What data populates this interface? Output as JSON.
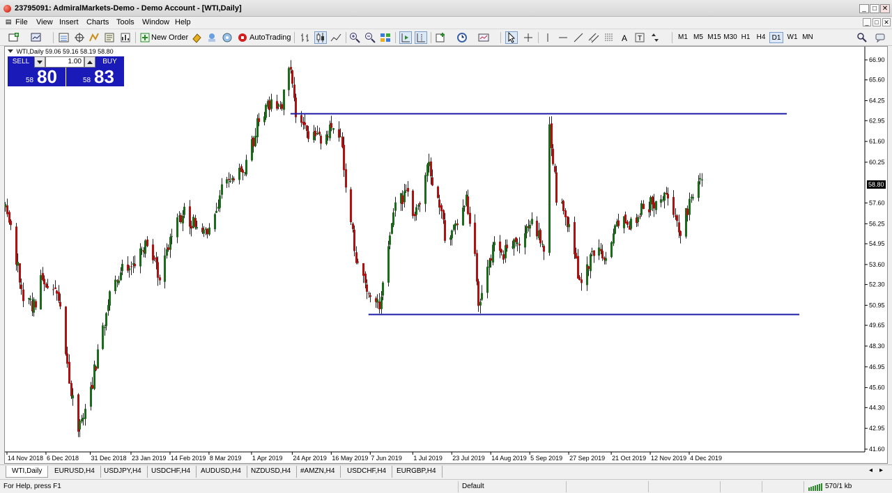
{
  "window": {
    "title": "23795091: AdmiralMarkets-Demo - Demo Account - [WTI,Daily]"
  },
  "menu": [
    "File",
    "View",
    "Insert",
    "Charts",
    "Tools",
    "Window",
    "Help"
  ],
  "toolbar": {
    "new_order": "New Order",
    "autotrading": "AutoTrading",
    "timeframes": [
      "M1",
      "M5",
      "M15",
      "M30",
      "H1",
      "H4",
      "D1",
      "W1",
      "MN"
    ],
    "active_timeframe": "D1"
  },
  "chart": {
    "header": "WTI,Daily  59.06 59.16 58.19 58.80",
    "one_click": {
      "sell_label": "SELL",
      "buy_label": "BUY",
      "volume": "1.00",
      "sell_small": "58",
      "sell_big": "80",
      "buy_small": "58",
      "buy_big": "83"
    },
    "current_price_label": "58.80",
    "colors": {
      "bull": "#1a6b1a",
      "bear": "#b01010",
      "wick": "#222222",
      "level_line": "#1c1ca8",
      "price_tag_bg": "#000000"
    }
  },
  "chart_data": {
    "type": "candlestick",
    "symbol": "WTI",
    "timeframe": "Daily",
    "y_ticks": [
      "66.90",
      "65.60",
      "64.25",
      "62.95",
      "61.60",
      "60.25",
      "58.80",
      "57.60",
      "56.25",
      "54.95",
      "53.60",
      "52.30",
      "50.95",
      "49.65",
      "48.30",
      "46.95",
      "45.60",
      "44.30",
      "42.95",
      "41.60"
    ],
    "ylim": [
      41.6,
      66.9
    ],
    "x_ticks": [
      "14 Nov 2018",
      "6 Dec 2018",
      "31 Dec 2018",
      "23 Jan 2019",
      "14 Feb 2019",
      "8 Mar 2019",
      "1 Apr 2019",
      "24 Apr 2019",
      "16 May 2019",
      "7 Jun 2019",
      "1 Jul 2019",
      "23 Jul 2019",
      "14 Aug 2019",
      "5 Sep 2019",
      "27 Sep 2019",
      "21 Oct 2019",
      "12 Nov 2019",
      "4 Dec 2019"
    ],
    "horizontal_levels": [
      {
        "price": 63.4,
        "from": "23 Apr 2019",
        "to": "end"
      },
      {
        "price": 50.35,
        "from": "6 Jun 2019",
        "to": "end"
      }
    ],
    "last_close": 58.8,
    "anchors": [
      {
        "date": "12 Nov 2018",
        "close": 57.8
      },
      {
        "date": "16 Nov 2018",
        "close": 56.4
      },
      {
        "date": "23 Nov 2018",
        "close": 50.9
      },
      {
        "date": "30 Nov 2018",
        "close": 50.9
      },
      {
        "date": "4 Dec 2018",
        "close": 52.9
      },
      {
        "date": "13 Dec 2018",
        "close": 51.5
      },
      {
        "date": "19 Dec 2018",
        "close": 46.2
      },
      {
        "date": "24 Dec 2018",
        "close": 43.0
      },
      {
        "date": "31 Dec 2018",
        "close": 45.4
      },
      {
        "date": "4 Jan 2019",
        "close": 47.9
      },
      {
        "date": "11 Jan 2019",
        "close": 51.6
      },
      {
        "date": "18 Jan 2019",
        "close": 53.6
      },
      {
        "date": "25 Jan 2019",
        "close": 53.5
      },
      {
        "date": "1 Feb 2019",
        "close": 55.3
      },
      {
        "date": "8 Feb 2019",
        "close": 52.7
      },
      {
        "date": "15 Feb 2019",
        "close": 55.6
      },
      {
        "date": "22 Feb 2019",
        "close": 57.2
      },
      {
        "date": "1 Mar 2019",
        "close": 55.8
      },
      {
        "date": "8 Mar 2019",
        "close": 56.1
      },
      {
        "date": "15 Mar 2019",
        "close": 58.5
      },
      {
        "date": "22 Mar 2019",
        "close": 59.0
      },
      {
        "date": "29 Mar 2019",
        "close": 60.1
      },
      {
        "date": "5 Apr 2019",
        "close": 63.1
      },
      {
        "date": "12 Apr 2019",
        "close": 63.9
      },
      {
        "date": "18 Apr 2019",
        "close": 64.0
      },
      {
        "date": "23 Apr 2019",
        "close": 66.3
      },
      {
        "date": "26 Apr 2019",
        "close": 63.3
      },
      {
        "date": "3 May 2019",
        "close": 61.9
      },
      {
        "date": "10 May 2019",
        "close": 61.7
      },
      {
        "date": "17 May 2019",
        "close": 62.8
      },
      {
        "date": "22 May 2019",
        "close": 61.4
      },
      {
        "date": "24 May 2019",
        "close": 58.6
      },
      {
        "date": "31 May 2019",
        "close": 53.5
      },
      {
        "date": "5 Jun 2019",
        "close": 51.7
      },
      {
        "date": "12 Jun 2019",
        "close": 51.1
      },
      {
        "date": "14 Jun 2019",
        "close": 52.5
      },
      {
        "date": "21 Jun 2019",
        "close": 57.4
      },
      {
        "date": "28 Jun 2019",
        "close": 58.5
      },
      {
        "date": "2 Jul 2019",
        "close": 56.3
      },
      {
        "date": "10 Jul 2019",
        "close": 60.4
      },
      {
        "date": "15 Jul 2019",
        "close": 57.6
      },
      {
        "date": "19 Jul 2019",
        "close": 55.6
      },
      {
        "date": "26 Jul 2019",
        "close": 56.2
      },
      {
        "date": "31 Jul 2019",
        "close": 58.1
      },
      {
        "date": "5 Aug 2019",
        "close": 54.7
      },
      {
        "date": "7 Aug 2019",
        "close": 51.1
      },
      {
        "date": "16 Aug 2019",
        "close": 54.9
      },
      {
        "date": "23 Aug 2019",
        "close": 54.2
      },
      {
        "date": "30 Aug 2019",
        "close": 55.1
      },
      {
        "date": "6 Sep 2019",
        "close": 56.5
      },
      {
        "date": "13 Sep 2019",
        "close": 54.8
      },
      {
        "date": "16 Sep 2019",
        "close": 62.5
      },
      {
        "date": "20 Sep 2019",
        "close": 58.1
      },
      {
        "date": "27 Sep 2019",
        "close": 55.9
      },
      {
        "date": "3 Oct 2019",
        "close": 52.4
      },
      {
        "date": "11 Oct 2019",
        "close": 54.7
      },
      {
        "date": "18 Oct 2019",
        "close": 53.8
      },
      {
        "date": "25 Oct 2019",
        "close": 56.6
      },
      {
        "date": "1 Nov 2019",
        "close": 56.2
      },
      {
        "date": "8 Nov 2019",
        "close": 57.2
      },
      {
        "date": "15 Nov 2019",
        "close": 57.7
      },
      {
        "date": "22 Nov 2019",
        "close": 58.0
      },
      {
        "date": "29 Nov 2019",
        "close": 55.2
      },
      {
        "date": "5 Dec 2019",
        "close": 58.4
      },
      {
        "date": "11 Dec 2019",
        "close": 58.8
      }
    ]
  },
  "tabs": [
    "WTI,Daily",
    "EURUSD,H4",
    "USDJPY,H4",
    "USDCHF,H4",
    "AUDUSD,H4",
    "NZDUSD,H4",
    "#AMZN,H4",
    "USDCHF,H4",
    "EURGBP,H4"
  ],
  "status": {
    "help": "For Help, press F1",
    "profile": "Default",
    "traffic": "570/1 kb"
  }
}
